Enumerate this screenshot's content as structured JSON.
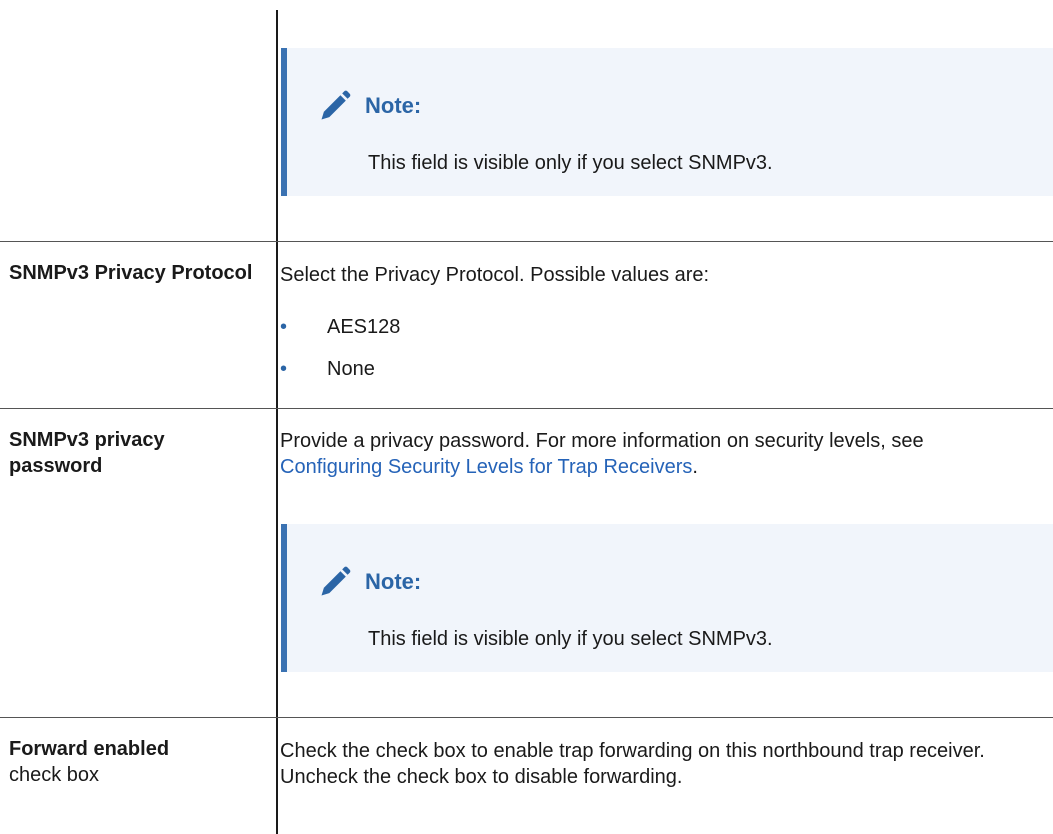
{
  "note1": {
    "title": "Note:",
    "text": "This field is visible only if you select SNMPv3."
  },
  "rows": [
    {
      "term": "SNMPv3 Privacy Protocol",
      "description": "Select the Privacy Protocol. Possible values are:",
      "options": [
        "AES128",
        "None"
      ]
    },
    {
      "term": "SNMPv3 privacy password",
      "description_before_link": "Provide a privacy password. For more information on security levels, see ",
      "link_text": "Configuring Security Levels for Trap Receivers",
      "description_after_link": "."
    },
    {
      "term": "Forward enabled",
      "term_suffix": "check box",
      "description": "Check the check box to enable trap forwarding on this northbound trap receiver. Uncheck the check box to disable forwarding."
    }
  ],
  "note2": {
    "title": "Note:",
    "text": "This field is visible only if you select SNMPv3."
  },
  "colors": {
    "note_bg": "#f1f5fb",
    "note_border": "#3a72b2",
    "note_title": "#2b65a6",
    "link": "#2563b8"
  },
  "icons": {
    "note_icon": "pencil-icon"
  }
}
